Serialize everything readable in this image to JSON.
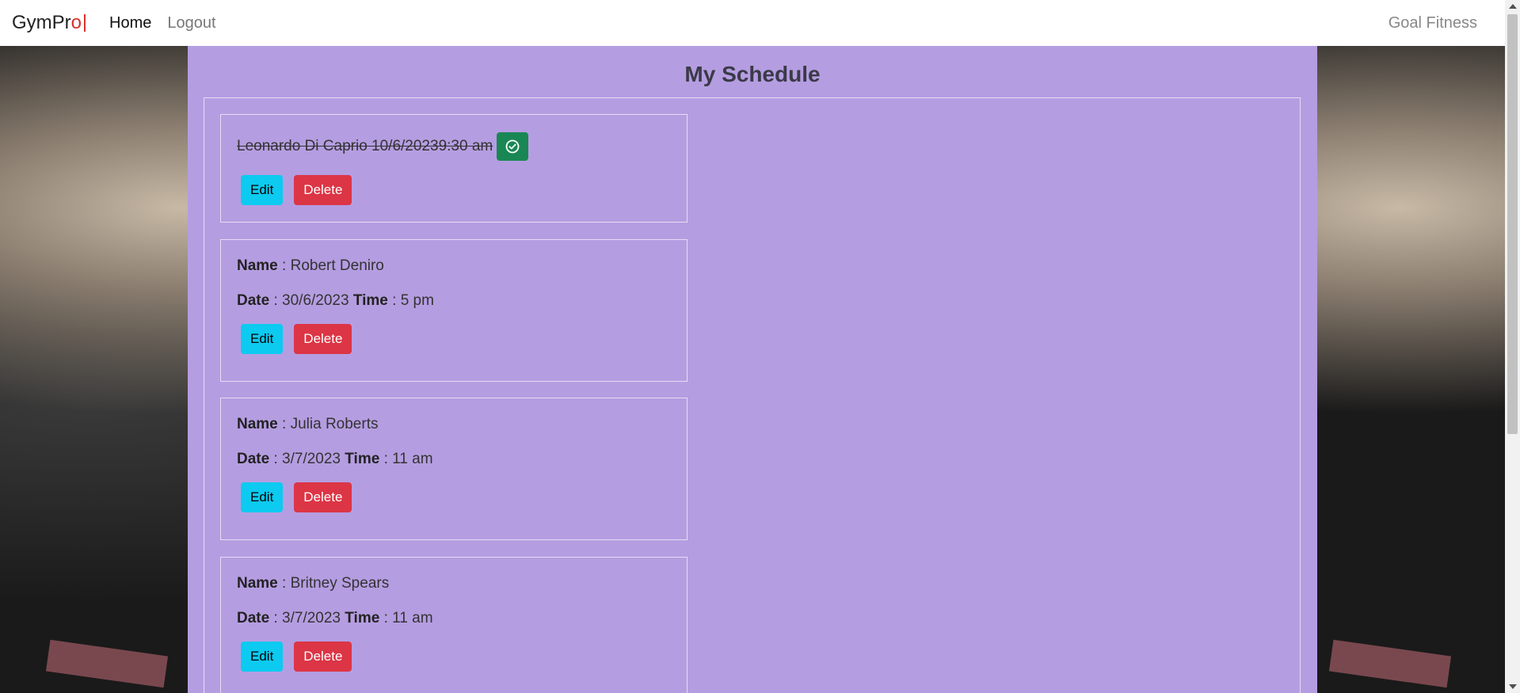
{
  "navbar": {
    "brand_main": "GymPr",
    "brand_accent": "o",
    "links": [
      "Home",
      "Logout"
    ],
    "right_text": "Goal Fitness"
  },
  "page": {
    "title": "My Schedule"
  },
  "schedule": {
    "completed_entry": {
      "text": "Leonardo Di Caprio 10/6/20239:30 am"
    },
    "labels": {
      "name": "Name",
      "date": "Date",
      "time": "Time",
      "sep": " : "
    },
    "entries": [
      {
        "name": "Robert Deniro",
        "date": "30/6/2023",
        "time": "5 pm"
      },
      {
        "name": "Julia Roberts",
        "date": "3/7/2023",
        "time": "11 am"
      },
      {
        "name": "Britney Spears",
        "date": "3/7/2023",
        "time": "11 am"
      }
    ],
    "buttons": {
      "edit": "Edit",
      "delete": "Delete"
    }
  },
  "colors": {
    "panel": "#b59de1",
    "edit": "#0dcaf0",
    "delete": "#dc3545",
    "done": "#198754"
  },
  "icons": {
    "done": "check-circle-icon"
  }
}
